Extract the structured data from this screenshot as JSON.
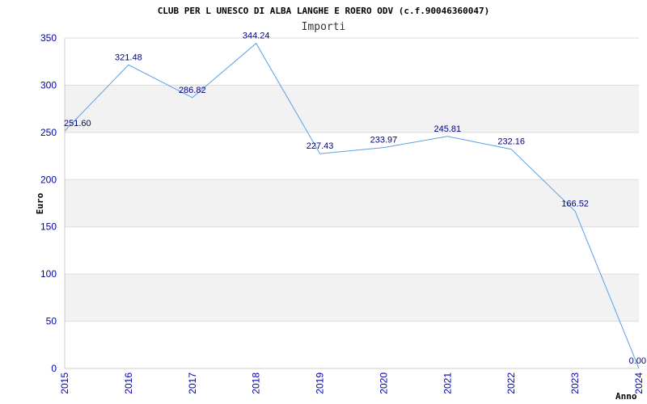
{
  "chart_data": {
    "type": "line",
    "title": "CLUB PER L UNESCO DI ALBA LANGHE E ROERO ODV (c.f.90046360047)",
    "subtitle": "Importi",
    "xlabel": "Anno",
    "ylabel": "Euro",
    "ylim": [
      0,
      350
    ],
    "yticks": [
      "0",
      "50",
      "100",
      "150",
      "200",
      "250",
      "300",
      "350"
    ],
    "categories": [
      "2015",
      "2016",
      "2017",
      "2018",
      "2019",
      "2020",
      "2021",
      "2022",
      "2023",
      "2024"
    ],
    "values": [
      251.6,
      321.48,
      286.82,
      344.24,
      227.43,
      233.97,
      245.81,
      232.16,
      166.52,
      0.0
    ],
    "value_labels": [
      "251.60",
      "321.48",
      "286.82",
      "344.24",
      "227.43",
      "233.97",
      "245.81",
      "232.16",
      "166.52",
      "0.00"
    ],
    "grid": true,
    "colors": {
      "line": "#5aa0e6",
      "band": "#f2f2f2",
      "tick": "#0000aa",
      "label": "#000080"
    }
  }
}
